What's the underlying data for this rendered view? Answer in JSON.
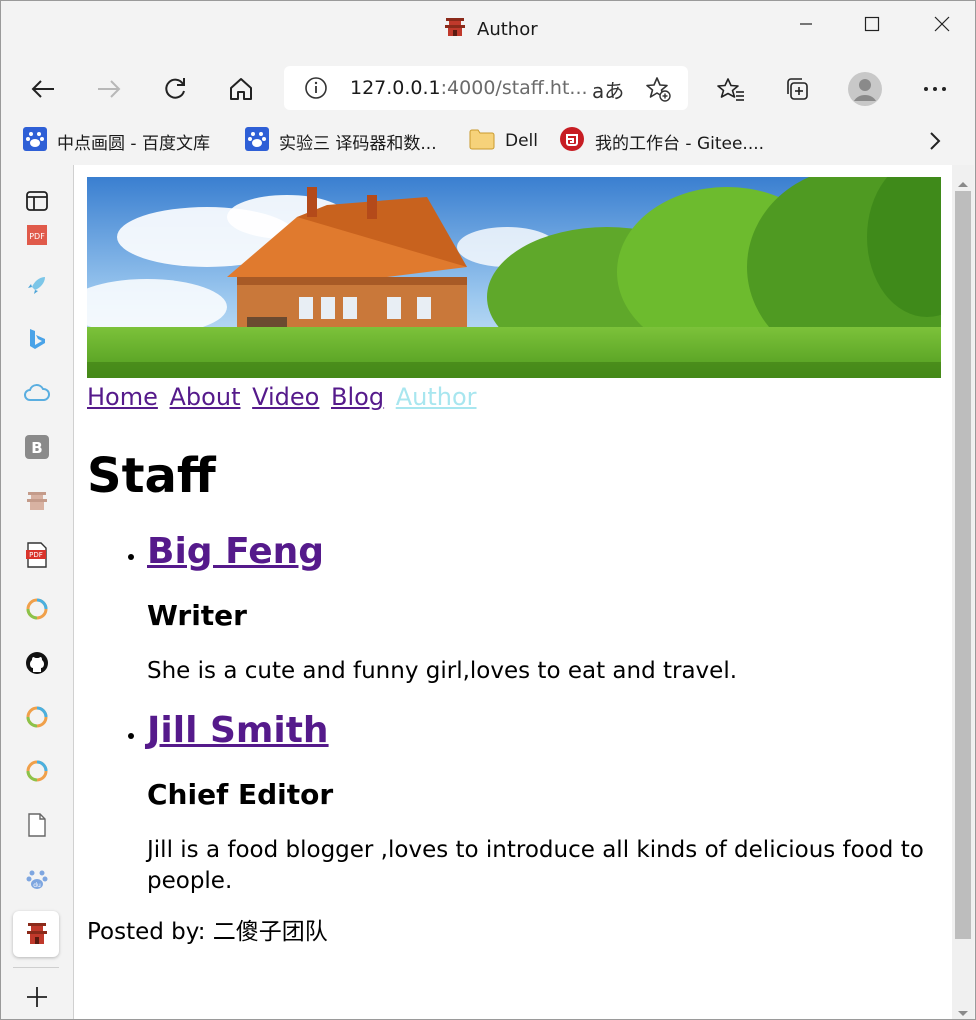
{
  "window": {
    "title": "Author",
    "minimize": "minimize",
    "maximize": "maximize",
    "close": "close"
  },
  "toolbar": {
    "url_host": "127.0.0.1",
    "url_rest": ":4000/staff.ht...",
    "read_aloud_label": "aあ"
  },
  "favorites": [
    {
      "label": "中点画圆 - 百度文库",
      "icon": "baidu-paw-icon"
    },
    {
      "label": "实验三 译码器和数...",
      "icon": "baidu-paw-icon"
    },
    {
      "label": "Dell",
      "icon": "folder-icon"
    },
    {
      "label": "我的工作台 - Gitee....",
      "icon": "gitee-icon"
    }
  ],
  "sidebar_icons": [
    "tab-icon",
    "pdf-icon",
    "rocket-icon",
    "bing-icon",
    "cloud-icon",
    "b-icon",
    "pagoda-icon",
    "pdf-icon",
    "circle-app-icon",
    "github-icon",
    "circle-app-icon",
    "circle-app-icon",
    "file-icon",
    "baidu-du-icon",
    "pagoda-icon",
    "plus-icon"
  ],
  "page": {
    "nav": [
      "Home",
      "About",
      "Video",
      "Blog",
      "Author"
    ],
    "heading": "Staff",
    "staff": [
      {
        "name": "Big Feng",
        "role": "Writer",
        "bio": "She is a cute and funny girl,loves to eat and travel."
      },
      {
        "name": "Jill Smith",
        "role": "Chief Editor",
        "bio": "Jill is a food blogger ,loves to introduce all kinds of delicious food to people."
      }
    ],
    "footer": "Posted by: 二傻子团队"
  },
  "colors": {
    "link_visited": "#551a8b",
    "nav_current": "#a8e6ef",
    "chrome_bg": "#f3f3f3"
  }
}
